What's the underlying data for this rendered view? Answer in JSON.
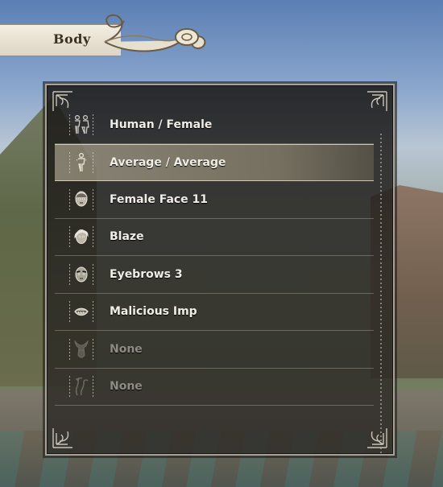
{
  "header": {
    "title": "Body"
  },
  "list": {
    "items": [
      {
        "label": "Human / Female",
        "icon": "body-type-icon",
        "selected": false,
        "enabled": true
      },
      {
        "label": "Average / Average",
        "icon": "physique-icon",
        "selected": true,
        "enabled": true
      },
      {
        "label": "Female Face 11",
        "icon": "face-icon",
        "selected": false,
        "enabled": true
      },
      {
        "label": "Blaze",
        "icon": "hair-icon",
        "selected": false,
        "enabled": true
      },
      {
        "label": "Eyebrows 3",
        "icon": "eyebrows-icon",
        "selected": false,
        "enabled": true
      },
      {
        "label": "Malicious Imp",
        "icon": "mouth-icon",
        "selected": false,
        "enabled": true
      },
      {
        "label": "None",
        "icon": "horns-icon",
        "selected": false,
        "enabled": false
      },
      {
        "label": "None",
        "icon": "tail-icon",
        "selected": false,
        "enabled": false
      }
    ]
  },
  "colors": {
    "panel_bg": "#262421",
    "panel_border": "#a9a397",
    "selected_row": "#c9bf9f",
    "text": "#f1eee8",
    "disabled_text": "#8f8c86"
  }
}
